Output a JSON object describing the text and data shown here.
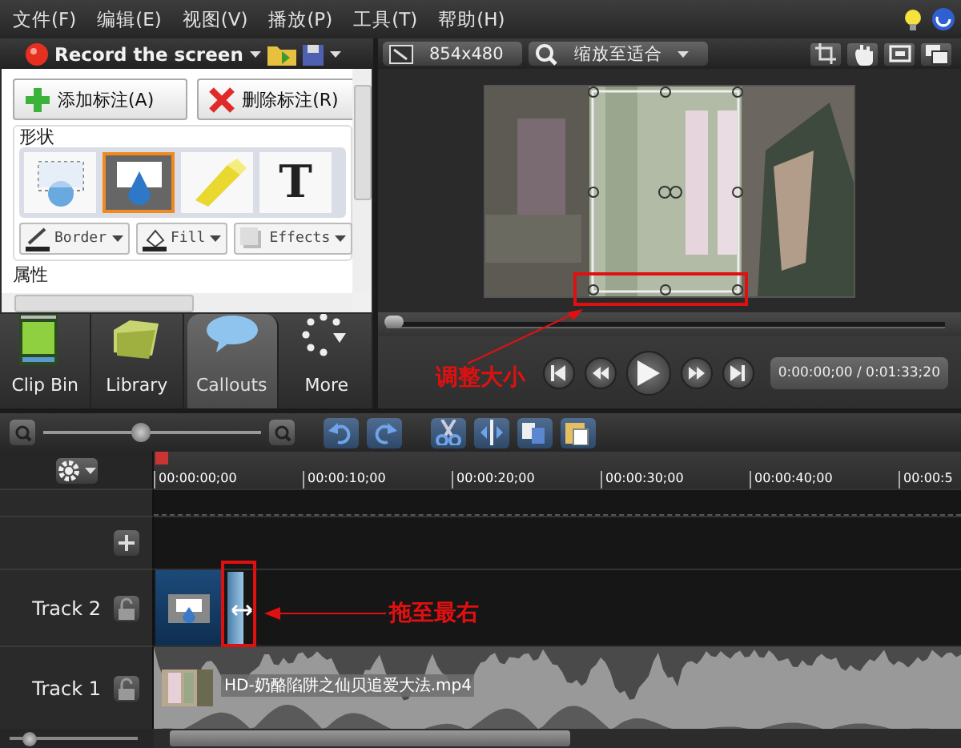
{
  "menu": {
    "items": [
      "文件(F)",
      "编辑(E)",
      "视图(V)",
      "播放(P)",
      "工具(T)",
      "帮助(H)"
    ]
  },
  "left_panel": {
    "record_label": "Record the screen",
    "buttons": [
      {
        "kind": "add",
        "label": "添加标注(A)"
      },
      {
        "kind": "delete",
        "label": "删除标注(R)"
      }
    ],
    "shapes_title": "形状",
    "shapes": [
      {
        "kind": "bubble",
        "selected": false
      },
      {
        "kind": "drop",
        "selected": true
      },
      {
        "kind": "marker",
        "selected": false
      },
      {
        "kind": "text",
        "label": "T",
        "selected": false
      }
    ],
    "style_buttons": [
      {
        "kind": "border",
        "label": "Border"
      },
      {
        "kind": "fill",
        "label": "Fill"
      },
      {
        "kind": "effects",
        "label": "Effects"
      }
    ],
    "properties_title": "属性"
  },
  "tabs": [
    {
      "kind": "clipbin",
      "label": "Clip Bin",
      "selected": false
    },
    {
      "kind": "library",
      "label": "Library",
      "selected": false
    },
    {
      "kind": "callouts",
      "label": "Callouts",
      "selected": true
    },
    {
      "kind": "more",
      "label": "More",
      "selected": false
    }
  ],
  "preview": {
    "resolution": "854x480",
    "zoom": "缩放至适合",
    "scrubber": {
      "level": 0
    },
    "time": "0:00:00;00 / 0:01:33;20"
  },
  "annotations": [
    {
      "kind": "resize",
      "text": "调整大小"
    },
    {
      "kind": "drag",
      "text": "拖至最右"
    }
  ],
  "timeline": {
    "zoom_slider": {
      "level": 0.45
    },
    "ticks": [
      "00:00:00;00",
      "00:00:10;00",
      "00:00:20;00",
      "00:00:30;00",
      "00:00:40;00",
      "00:00:5"
    ],
    "tracks": [
      {
        "name": "Track 2",
        "kind": "callout"
      },
      {
        "name": "Track 1",
        "kind": "video",
        "clip": "HD-奶酪陷阱之仙贝追爱大法.mp4"
      }
    ],
    "bottom_slider": {
      "level": 0.15
    }
  }
}
